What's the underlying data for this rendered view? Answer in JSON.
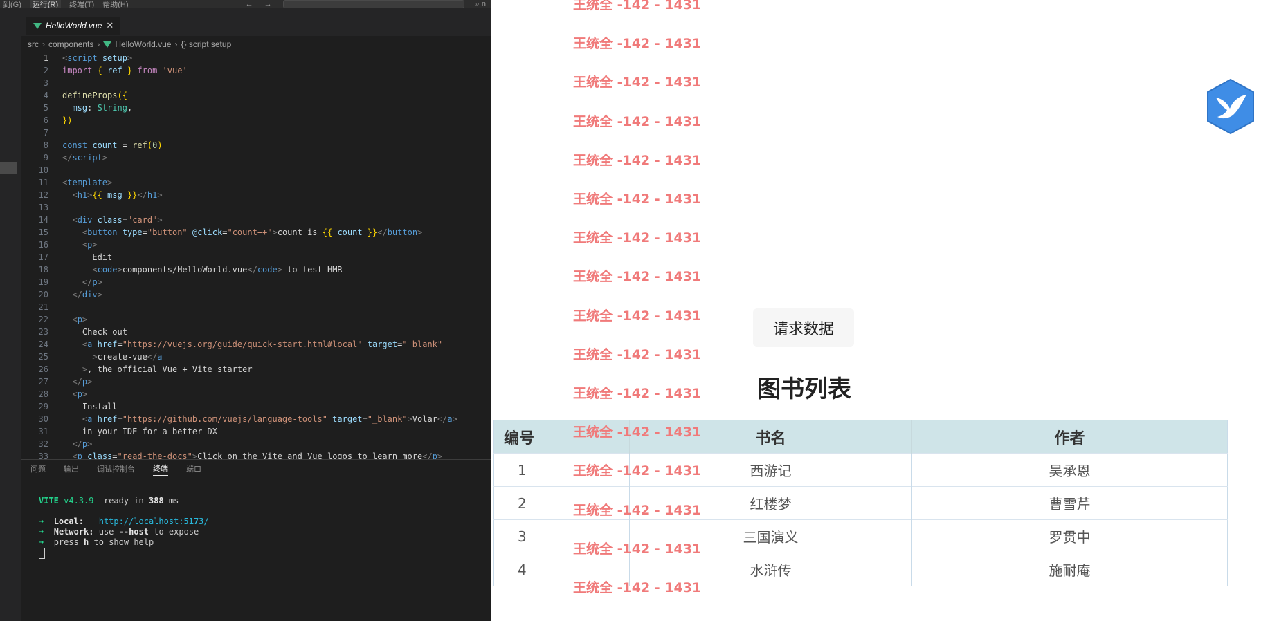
{
  "editor": {
    "menu": [
      "到(G)",
      "运行(R)",
      "终端(T)",
      "帮助(H)"
    ],
    "active_menu_index": 1,
    "nav": {
      "back": "←",
      "forward": "→",
      "search_glyph": "⌕ n"
    },
    "tab": {
      "filename": "HelloWorld.vue",
      "close": "✕"
    },
    "breadcrumb": {
      "src": "src",
      "components": "components",
      "file": "HelloWorld.vue",
      "symbol": "{} script setup"
    },
    "code_line_numbers": [
      "1",
      "2",
      "3",
      "4",
      "5",
      "6",
      "7",
      "8",
      "9",
      "10",
      "11",
      "12",
      "13",
      "14",
      "15",
      "16",
      "17",
      "18",
      "19",
      "20",
      "21",
      "22",
      "23",
      "24",
      "25",
      "26",
      "27",
      "28",
      "29",
      "30",
      "31",
      "32",
      "33"
    ],
    "code_lines": [
      [
        {
          "c": "t-tagd",
          "t": "<"
        },
        {
          "c": "t-tag",
          "t": "script"
        },
        {
          "c": "t-attr",
          "t": " setup"
        },
        {
          "c": "t-tagd",
          "t": ">"
        }
      ],
      [
        {
          "c": "t-kw",
          "t": "import"
        },
        {
          "c": "t-plain",
          "t": " "
        },
        {
          "c": "t-br",
          "t": "{"
        },
        {
          "c": "t-var",
          "t": " ref "
        },
        {
          "c": "t-br",
          "t": "}"
        },
        {
          "c": "t-kw",
          "t": " from "
        },
        {
          "c": "t-str",
          "t": "'vue'"
        }
      ],
      [],
      [
        {
          "c": "t-fn",
          "t": "defineProps"
        },
        {
          "c": "t-br",
          "t": "({"
        }
      ],
      [
        {
          "c": "t-var",
          "t": "  msg"
        },
        {
          "c": "t-plain",
          "t": ": "
        },
        {
          "c": "t-type",
          "t": "String"
        },
        {
          "c": "t-plain",
          "t": ","
        }
      ],
      [
        {
          "c": "t-br",
          "t": "})"
        }
      ],
      [],
      [
        {
          "c": "t-tag",
          "t": "const"
        },
        {
          "c": "t-var",
          "t": " count"
        },
        {
          "c": "t-plain",
          "t": " = "
        },
        {
          "c": "t-fn",
          "t": "ref"
        },
        {
          "c": "t-br",
          "t": "("
        },
        {
          "c": "t-num",
          "t": "0"
        },
        {
          "c": "t-br",
          "t": ")"
        }
      ],
      [
        {
          "c": "t-tagd",
          "t": "</"
        },
        {
          "c": "t-tag",
          "t": "script"
        },
        {
          "c": "t-tagd",
          "t": ">"
        }
      ],
      [],
      [
        {
          "c": "t-tagd",
          "t": "<"
        },
        {
          "c": "t-tag",
          "t": "template"
        },
        {
          "c": "t-tagd",
          "t": ">"
        }
      ],
      [
        {
          "c": "t-plain",
          "t": "  "
        },
        {
          "c": "t-tagd",
          "t": "<"
        },
        {
          "c": "t-tag",
          "t": "h1"
        },
        {
          "c": "t-tagd",
          "t": ">"
        },
        {
          "c": "t-br",
          "t": "{{"
        },
        {
          "c": "t-var",
          "t": " msg "
        },
        {
          "c": "t-br",
          "t": "}}"
        },
        {
          "c": "t-tagd",
          "t": "</"
        },
        {
          "c": "t-tag",
          "t": "h1"
        },
        {
          "c": "t-tagd",
          "t": ">"
        }
      ],
      [],
      [
        {
          "c": "t-plain",
          "t": "  "
        },
        {
          "c": "t-tagd",
          "t": "<"
        },
        {
          "c": "t-tag",
          "t": "div"
        },
        {
          "c": "t-attr",
          "t": " class"
        },
        {
          "c": "t-plain",
          "t": "="
        },
        {
          "c": "t-str",
          "t": "\"card\""
        },
        {
          "c": "t-tagd",
          "t": ">"
        }
      ],
      [
        {
          "c": "t-plain",
          "t": "    "
        },
        {
          "c": "t-tagd",
          "t": "<"
        },
        {
          "c": "t-tag",
          "t": "button"
        },
        {
          "c": "t-attr",
          "t": " type"
        },
        {
          "c": "t-plain",
          "t": "="
        },
        {
          "c": "t-str",
          "t": "\"button\""
        },
        {
          "c": "t-attr",
          "t": " @click"
        },
        {
          "c": "t-plain",
          "t": "="
        },
        {
          "c": "t-str",
          "t": "\"count++\""
        },
        {
          "c": "t-tagd",
          "t": ">"
        },
        {
          "c": "t-plain",
          "t": "count is "
        },
        {
          "c": "t-br",
          "t": "{{"
        },
        {
          "c": "t-var",
          "t": " count "
        },
        {
          "c": "t-br",
          "t": "}}"
        },
        {
          "c": "t-tagd",
          "t": "</"
        },
        {
          "c": "t-tag",
          "t": "button"
        },
        {
          "c": "t-tagd",
          "t": ">"
        }
      ],
      [
        {
          "c": "t-plain",
          "t": "    "
        },
        {
          "c": "t-tagd",
          "t": "<"
        },
        {
          "c": "t-tag",
          "t": "p"
        },
        {
          "c": "t-tagd",
          "t": ">"
        }
      ],
      [
        {
          "c": "t-plain",
          "t": "      Edit"
        }
      ],
      [
        {
          "c": "t-plain",
          "t": "      "
        },
        {
          "c": "t-tagd",
          "t": "<"
        },
        {
          "c": "t-tag",
          "t": "code"
        },
        {
          "c": "t-tagd",
          "t": ">"
        },
        {
          "c": "t-plain",
          "t": "components/HelloWorld.vue"
        },
        {
          "c": "t-tagd",
          "t": "</"
        },
        {
          "c": "t-tag",
          "t": "code"
        },
        {
          "c": "t-tagd",
          "t": ">"
        },
        {
          "c": "t-plain",
          "t": " to test HMR"
        }
      ],
      [
        {
          "c": "t-plain",
          "t": "    "
        },
        {
          "c": "t-tagd",
          "t": "</"
        },
        {
          "c": "t-tag",
          "t": "p"
        },
        {
          "c": "t-tagd",
          "t": ">"
        }
      ],
      [
        {
          "c": "t-plain",
          "t": "  "
        },
        {
          "c": "t-tagd",
          "t": "</"
        },
        {
          "c": "t-tag",
          "t": "div"
        },
        {
          "c": "t-tagd",
          "t": ">"
        }
      ],
      [],
      [
        {
          "c": "t-plain",
          "t": "  "
        },
        {
          "c": "t-tagd",
          "t": "<"
        },
        {
          "c": "t-tag",
          "t": "p"
        },
        {
          "c": "t-tagd",
          "t": ">"
        }
      ],
      [
        {
          "c": "t-plain",
          "t": "    Check out"
        }
      ],
      [
        {
          "c": "t-plain",
          "t": "    "
        },
        {
          "c": "t-tagd",
          "t": "<"
        },
        {
          "c": "t-tag",
          "t": "a"
        },
        {
          "c": "t-attr",
          "t": " href"
        },
        {
          "c": "t-plain",
          "t": "="
        },
        {
          "c": "t-str",
          "t": "\"https://vuejs.org/guide/quick-start.html#local\""
        },
        {
          "c": "t-attr",
          "t": " target"
        },
        {
          "c": "t-plain",
          "t": "="
        },
        {
          "c": "t-str",
          "t": "\"_blank\""
        }
      ],
      [
        {
          "c": "t-plain",
          "t": "      "
        },
        {
          "c": "t-tagd",
          "t": ">"
        },
        {
          "c": "t-plain",
          "t": "create-vue"
        },
        {
          "c": "t-tagd",
          "t": "</"
        },
        {
          "c": "t-tag",
          "t": "a"
        }
      ],
      [
        {
          "c": "t-plain",
          "t": "    "
        },
        {
          "c": "t-tagd",
          "t": ">"
        },
        {
          "c": "t-plain",
          "t": ", the official Vue + Vite starter"
        }
      ],
      [
        {
          "c": "t-plain",
          "t": "  "
        },
        {
          "c": "t-tagd",
          "t": "</"
        },
        {
          "c": "t-tag",
          "t": "p"
        },
        {
          "c": "t-tagd",
          "t": ">"
        }
      ],
      [
        {
          "c": "t-plain",
          "t": "  "
        },
        {
          "c": "t-tagd",
          "t": "<"
        },
        {
          "c": "t-tag",
          "t": "p"
        },
        {
          "c": "t-tagd",
          "t": ">"
        }
      ],
      [
        {
          "c": "t-plain",
          "t": "    Install"
        }
      ],
      [
        {
          "c": "t-plain",
          "t": "    "
        },
        {
          "c": "t-tagd",
          "t": "<"
        },
        {
          "c": "t-tag",
          "t": "a"
        },
        {
          "c": "t-attr",
          "t": " href"
        },
        {
          "c": "t-plain",
          "t": "="
        },
        {
          "c": "t-str",
          "t": "\"https://github.com/vuejs/language-tools\""
        },
        {
          "c": "t-attr",
          "t": " target"
        },
        {
          "c": "t-plain",
          "t": "="
        },
        {
          "c": "t-str",
          "t": "\"_blank\""
        },
        {
          "c": "t-tagd",
          "t": ">"
        },
        {
          "c": "t-plain",
          "t": "Volar"
        },
        {
          "c": "t-tagd",
          "t": "</"
        },
        {
          "c": "t-tag",
          "t": "a"
        },
        {
          "c": "t-tagd",
          "t": ">"
        }
      ],
      [
        {
          "c": "t-plain",
          "t": "    in your IDE for a better DX"
        }
      ],
      [
        {
          "c": "t-plain",
          "t": "  "
        },
        {
          "c": "t-tagd",
          "t": "</"
        },
        {
          "c": "t-tag",
          "t": "p"
        },
        {
          "c": "t-tagd",
          "t": ">"
        }
      ],
      [
        {
          "c": "t-plain",
          "t": "  "
        },
        {
          "c": "t-tagd",
          "t": "<"
        },
        {
          "c": "t-tag",
          "t": "p"
        },
        {
          "c": "t-attr",
          "t": " class"
        },
        {
          "c": "t-plain",
          "t": "="
        },
        {
          "c": "t-str",
          "t": "\"read-the-docs\""
        },
        {
          "c": "t-tagd",
          "t": ">"
        },
        {
          "c": "t-plain",
          "t": "Click on the Vite and Vue logos to learn more"
        },
        {
          "c": "t-tagd",
          "t": "</"
        },
        {
          "c": "t-tag",
          "t": "p"
        },
        {
          "c": "t-tagd",
          "t": ">"
        }
      ]
    ],
    "panel_tabs": [
      "问题",
      "输出",
      "调试控制台",
      "终端",
      "端口"
    ],
    "active_panel_tab": 3,
    "terminal": {
      "vite": "VITE",
      "version": "v4.3.9",
      "ready": "ready in",
      "ms_value": "388",
      "ms_unit": "ms",
      "arrow": "➜",
      "local_label": "Local:",
      "local_url_prefix": "http://localhost:",
      "local_port": "5173",
      "local_url_suffix": "/",
      "network_label": "Network:",
      "network_text_a": "use",
      "network_flag": "--host",
      "network_text_b": "to expose",
      "help_a": "press",
      "help_key": "h",
      "help_b": "to show help"
    }
  },
  "webpage": {
    "watermark": "王统全 -142 - 1431",
    "request_button": "请求数据",
    "list_title": "图书列表",
    "table": {
      "headers": [
        "编号",
        "书名",
        "作者"
      ],
      "rows": [
        [
          "1",
          "西游记",
          "吴承恩"
        ],
        [
          "2",
          "红楼梦",
          "曹雪芹"
        ],
        [
          "3",
          "三国演义",
          "罗贯中"
        ],
        [
          "4",
          "水浒传",
          "施耐庵"
        ]
      ]
    },
    "floating_icon": "bird-logo-icon"
  },
  "colors": {
    "editor_bg": "#1e1e1e",
    "watermark": "#f07a7a",
    "table_header_bg": "#cfe4e8",
    "bird_blue": "#3f8de6"
  }
}
